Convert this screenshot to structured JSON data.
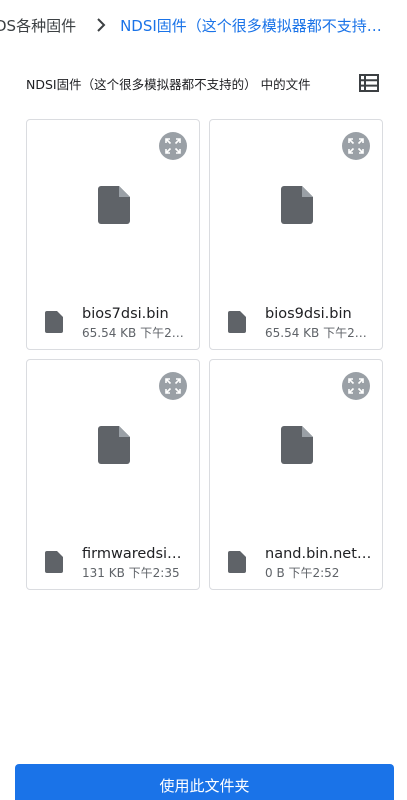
{
  "breadcrumb": {
    "parent": "DS各种固件",
    "current": "NDSI固件（这个很多模拟器都不支持…"
  },
  "section": {
    "title": "NDSI固件（这个很多模拟器都不支持的） 中的文件",
    "view_icon": "list-view-icon"
  },
  "files": [
    {
      "name": "bios7dsi.bin",
      "info": "65.54 KB 下午2…"
    },
    {
      "name": "bios9dsi.bin",
      "info": "65.54 KB 下午2…"
    },
    {
      "name": "firmwaredsi…",
      "info": "131 KB 下午2:35"
    },
    {
      "name": "nand.bin.net…",
      "info": "0 B 下午2:52"
    }
  ],
  "actions": {
    "use_folder": "使用此文件夹"
  },
  "colors": {
    "accent": "#1a73e8",
    "icon_gray": "#5f6368",
    "expand_bg": "#9aa0a6",
    "border": "#dadce0"
  }
}
